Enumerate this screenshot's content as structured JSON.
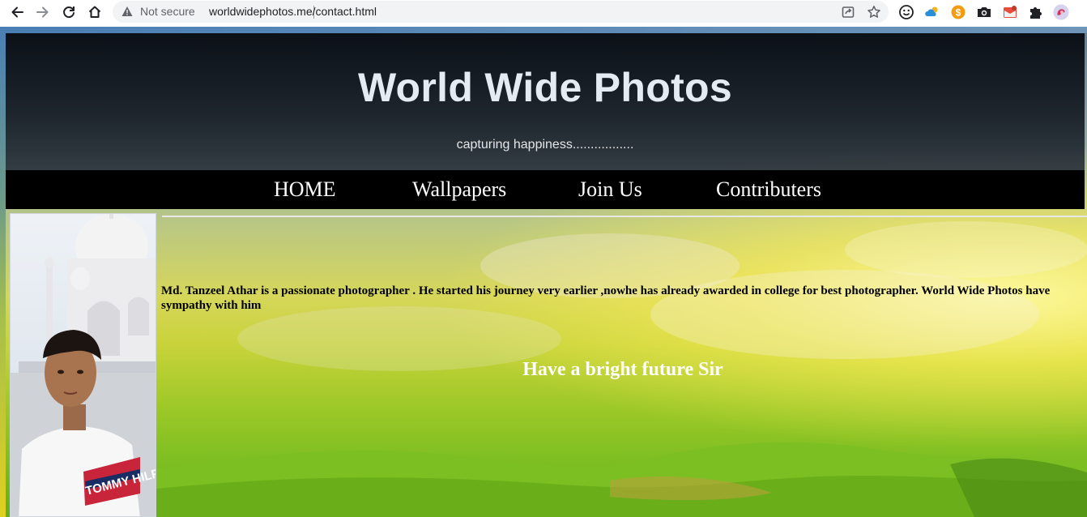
{
  "browser": {
    "security_label": "Not secure",
    "url": "worldwidephotos.me/contact.html"
  },
  "header": {
    "title": "World Wide Photos",
    "tagline": "capturing happiness................."
  },
  "nav": {
    "items": [
      {
        "label": "HOME"
      },
      {
        "label": "Wallpapers"
      },
      {
        "label": "Join Us"
      },
      {
        "label": "Contributers"
      }
    ]
  },
  "content": {
    "bio": "Md. Tanzeel Athar is a passionate photographer . He started his journey very earlier ,nowhe has already awarded in college for best photographer. World Wide Photos have sympathy with him",
    "wish": "Have a bright future Sir",
    "photo_text": "TOMMY HILFI"
  },
  "icons": [
    "back-icon",
    "forward-icon",
    "reload-icon",
    "home-icon",
    "warning-icon",
    "share-icon",
    "star-icon",
    "smiley-extension-icon",
    "cloud-extension-icon",
    "coin-extension-icon",
    "camera-extension-icon",
    "mail-extension-icon",
    "puzzle-extension-icon",
    "profile-avatar"
  ]
}
